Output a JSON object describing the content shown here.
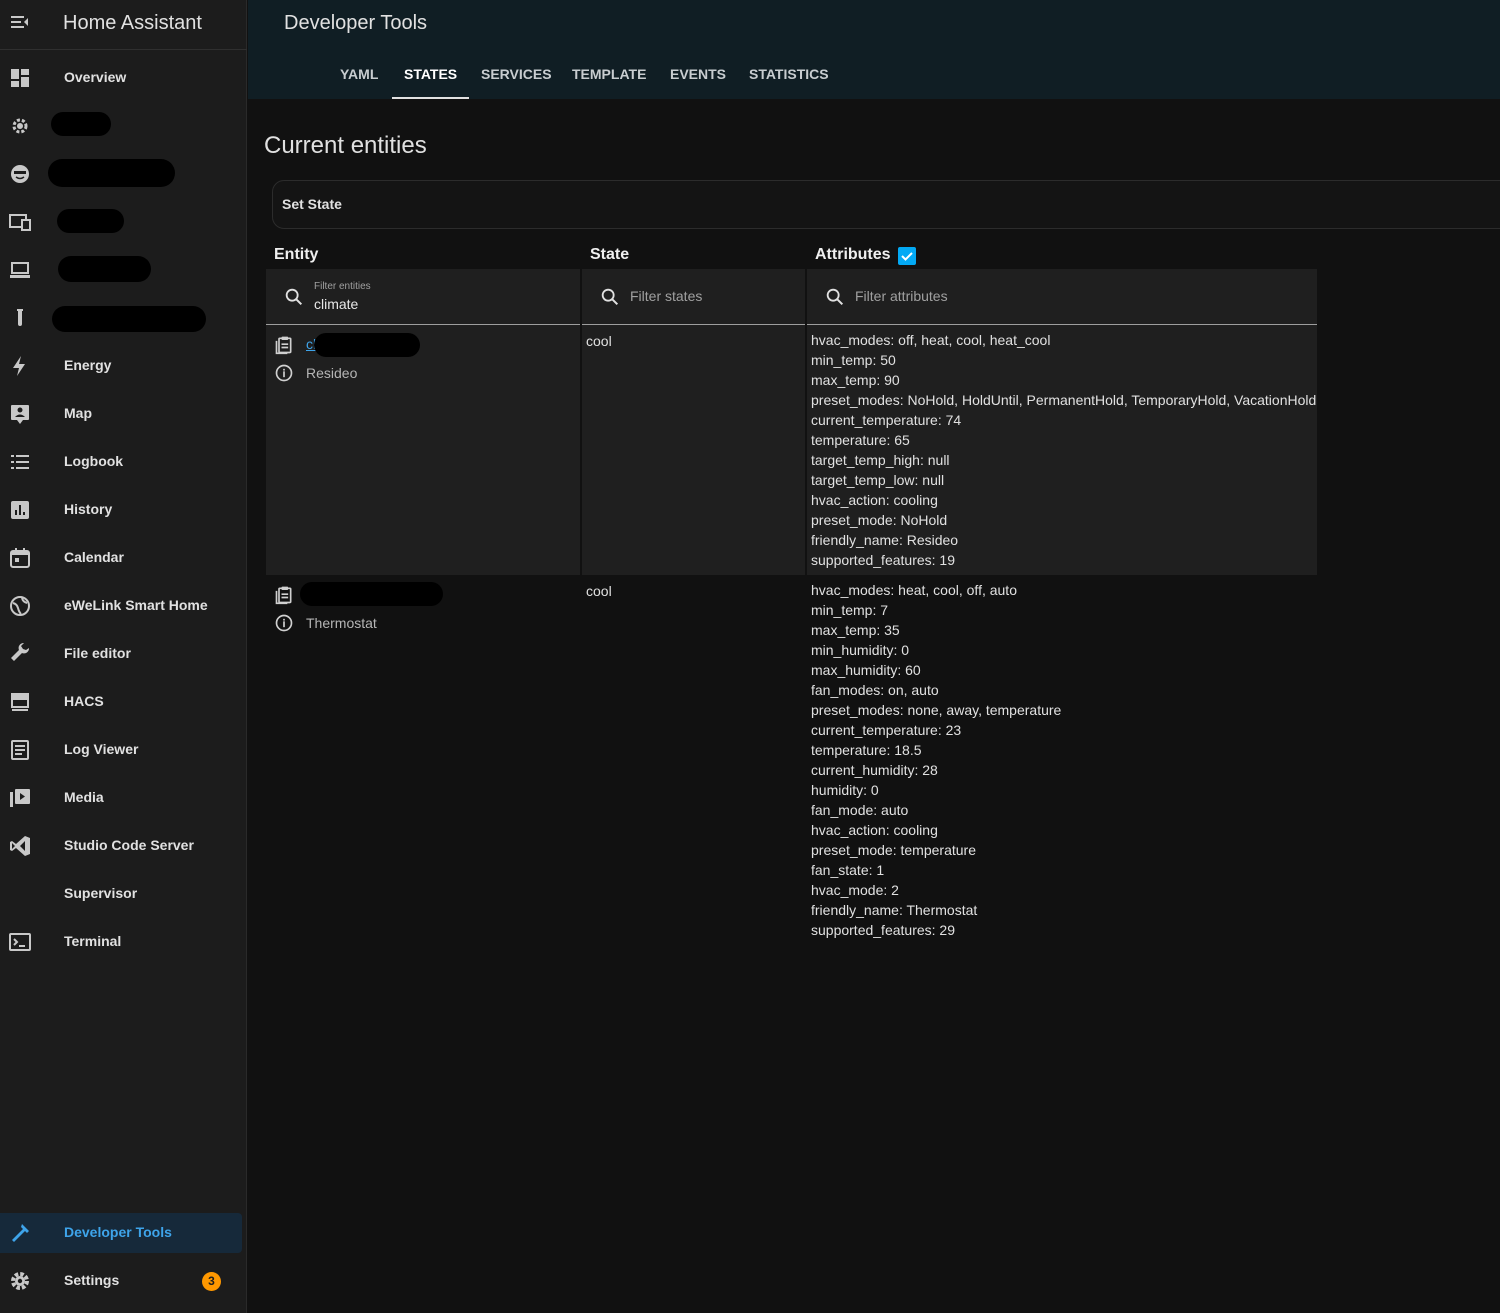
{
  "sidebar": {
    "title": "Home Assistant",
    "items": [
      {
        "label": "Overview",
        "icon": "dashboard-icon"
      },
      {
        "label": "",
        "icon": "gear-cog-icon"
      },
      {
        "label": "",
        "icon": "face-icon"
      },
      {
        "label": "",
        "icon": "devices-icon"
      },
      {
        "label": "",
        "icon": "laptop-icon"
      },
      {
        "label": "",
        "icon": "test-tube-icon"
      },
      {
        "label": "Energy",
        "icon": "lightning-icon"
      },
      {
        "label": "Map",
        "icon": "map-account-icon"
      },
      {
        "label": "Logbook",
        "icon": "list-icon"
      },
      {
        "label": "History",
        "icon": "chart-box-icon"
      },
      {
        "label": "Calendar",
        "icon": "calendar-icon"
      },
      {
        "label": "eWeLink Smart Home",
        "icon": "globe-icon"
      },
      {
        "label": "File editor",
        "icon": "wrench-icon"
      },
      {
        "label": "HACS",
        "icon": "hacs-icon"
      },
      {
        "label": "Log Viewer",
        "icon": "document-icon"
      },
      {
        "label": "Media",
        "icon": "play-box-icon"
      },
      {
        "label": "Studio Code Server",
        "icon": "vscode-icon"
      },
      {
        "label": "Supervisor",
        "icon": ""
      },
      {
        "label": "Terminal",
        "icon": "console-icon"
      }
    ],
    "developer_tools": "Developer Tools",
    "settings": "Settings",
    "settings_badge": "3"
  },
  "header": {
    "title": "Developer Tools",
    "tabs": [
      "YAML",
      "STATES",
      "SERVICES",
      "TEMPLATE",
      "EVENTS",
      "STATISTICS"
    ],
    "active_tab": "STATES"
  },
  "main": {
    "section_title": "Current entities",
    "set_state": "Set State",
    "columns": {
      "entity": "Entity",
      "state": "State",
      "attributes": "Attributes"
    },
    "attributes_checked": true,
    "filters": {
      "entities_label": "Filter entities",
      "entities_value": "climate",
      "states_placeholder": "Filter states",
      "attributes_placeholder": "Filter attributes"
    },
    "rows": [
      {
        "entity_id": "cl",
        "friendly_name": "Resideo",
        "state": "cool",
        "attributes": [
          "hvac_modes: off, heat, cool, heat_cool",
          "min_temp: 50",
          "max_temp: 90",
          "preset_modes: NoHold, HoldUntil, PermanentHold, TemporaryHold, VacationHold",
          "current_temperature: 74",
          "temperature: 65",
          "target_temp_high: null",
          "target_temp_low: null",
          "hvac_action: cooling",
          "preset_mode: NoHold",
          "friendly_name: Resideo",
          "supported_features: 19"
        ]
      },
      {
        "entity_id": "",
        "friendly_name": "Thermostat",
        "state": "cool",
        "attributes": [
          "hvac_modes: heat, cool, off, auto",
          "min_temp: 7",
          "max_temp: 35",
          "min_humidity: 0",
          "max_humidity: 60",
          "fan_modes: on, auto",
          "preset_modes: none, away, temperature",
          "current_temperature: 23",
          "temperature: 18.5",
          "current_humidity: 28",
          "humidity: 0",
          "fan_mode: auto",
          "hvac_action: cooling",
          "preset_mode: temperature",
          "fan_state: 1",
          "hvac_mode: 2",
          "friendly_name: Thermostat",
          "supported_features: 29"
        ]
      }
    ]
  },
  "colors": {
    "accent": "#03a9f4",
    "link": "#3ea4ea",
    "badge": "#ff9800",
    "topbar": "#101e24",
    "sidebar": "#1c1c1c"
  }
}
